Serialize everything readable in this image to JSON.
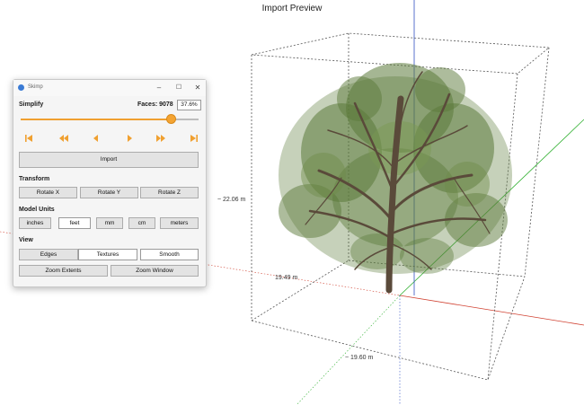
{
  "viewport": {
    "title": "Import Preview",
    "dimension_height": "~ 22.06 m",
    "dimension_depth": "19.49 m",
    "dimension_width": "~ 19.60 m"
  },
  "window": {
    "title": "Skimp",
    "controls": {
      "minimize": "–",
      "maximize": "☐",
      "close": "✕"
    }
  },
  "simplify": {
    "label": "Simplify",
    "faces_text": "Faces: 9078",
    "percent": "37.6%",
    "slider_fraction": 0.846
  },
  "navigation": {
    "icons": [
      "skip-to-start-icon",
      "rewind-icon",
      "step-back-icon",
      "play-icon",
      "fast-forward-icon",
      "skip-to-end-icon"
    ],
    "color": "#f0a030"
  },
  "import_label": "Import",
  "transform": {
    "label": "Transform",
    "rotate_x": "Rotate X",
    "rotate_y": "Rotate Y",
    "rotate_z": "Rotate Z"
  },
  "model_units": {
    "label": "Model Units",
    "options": [
      "inches",
      "feet",
      "mm",
      "cm",
      "meters"
    ],
    "selected": "feet"
  },
  "view": {
    "label": "View",
    "edges": "Edges",
    "textures": "Textures",
    "smooth": "Smooth",
    "zoom_extents": "Zoom Extents",
    "zoom_window": "Zoom Window",
    "selected": "Edges"
  },
  "colors": {
    "accent": "#f0a030",
    "axis_red": "#d04030",
    "axis_green": "#30b030",
    "axis_blue": "#3050c0",
    "foliage": "#5b7a3a",
    "trunk": "#5a4a3a"
  }
}
